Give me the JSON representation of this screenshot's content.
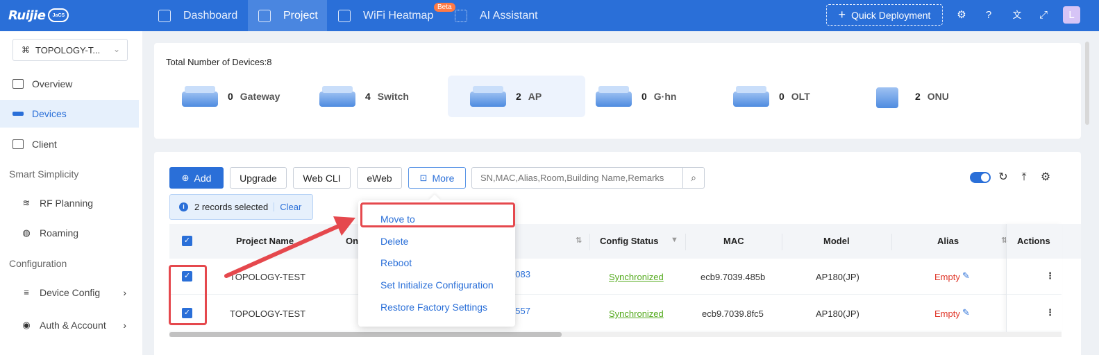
{
  "topbar": {
    "brand": "Ruijie",
    "cloud": "JaCS",
    "nav": [
      {
        "label": "Dashboard",
        "icon": "home-icon"
      },
      {
        "label": "Project",
        "icon": "cube-icon"
      },
      {
        "label": "WiFi Heatmap",
        "icon": "heatmap-icon",
        "badge": "Beta"
      },
      {
        "label": "AI Assistant",
        "icon": "grid-icon"
      }
    ],
    "quick_deployment": "Quick Deployment",
    "avatar": "L"
  },
  "sidebar": {
    "project": "TOPOLOGY-T...",
    "items": [
      {
        "label": "Overview"
      },
      {
        "label": "Devices"
      },
      {
        "label": "Client"
      }
    ],
    "sections": [
      "Smart Simplicity",
      "Configuration"
    ],
    "sub_items": [
      {
        "label": "RF Planning"
      },
      {
        "label": "Roaming"
      },
      {
        "label": "Device Config"
      },
      {
        "label": "Auth & Account"
      }
    ]
  },
  "summary": {
    "title": "Total Number of Devices:8",
    "types": [
      {
        "count": "0",
        "name": "Gateway"
      },
      {
        "count": "4",
        "name": "Switch"
      },
      {
        "count": "2",
        "name": "AP"
      },
      {
        "count": "0",
        "name": "G·hn"
      },
      {
        "count": "0",
        "name": "OLT"
      },
      {
        "count": "2",
        "name": "ONU"
      }
    ]
  },
  "toolbar": {
    "add": "Add",
    "upgrade": "Upgrade",
    "webcli": "Web CLI",
    "eweb": "eWeb",
    "more": "More",
    "search_placeholder": "SN,MAC,Alias,Room,Building Name,Remarks"
  },
  "selection": {
    "text": "2 records selected",
    "clear": "Clear"
  },
  "table": {
    "headers": {
      "project_name": "Project Name",
      "online": "On",
      "config_status": "Config Status",
      "mac": "MAC",
      "model": "Model",
      "alias": "Alias",
      "actions": "Actions"
    },
    "rows": [
      {
        "project": "TOPOLOGY-TEST",
        "sn_tail": "5083",
        "config": "Synchronized",
        "mac": "ecb9.7039.485b",
        "model": "AP180(JP)",
        "alias": "Empty"
      },
      {
        "project": "TOPOLOGY-TEST",
        "sn_tail": "5557",
        "config": "Synchronized",
        "mac": "ecb9.7039.8fc5",
        "model": "AP180(JP)",
        "alias": "Empty"
      }
    ]
  },
  "more_menu": [
    "Move to",
    "Delete",
    "Reboot",
    "Set Initialize Configuration",
    "Restore Factory Settings"
  ]
}
